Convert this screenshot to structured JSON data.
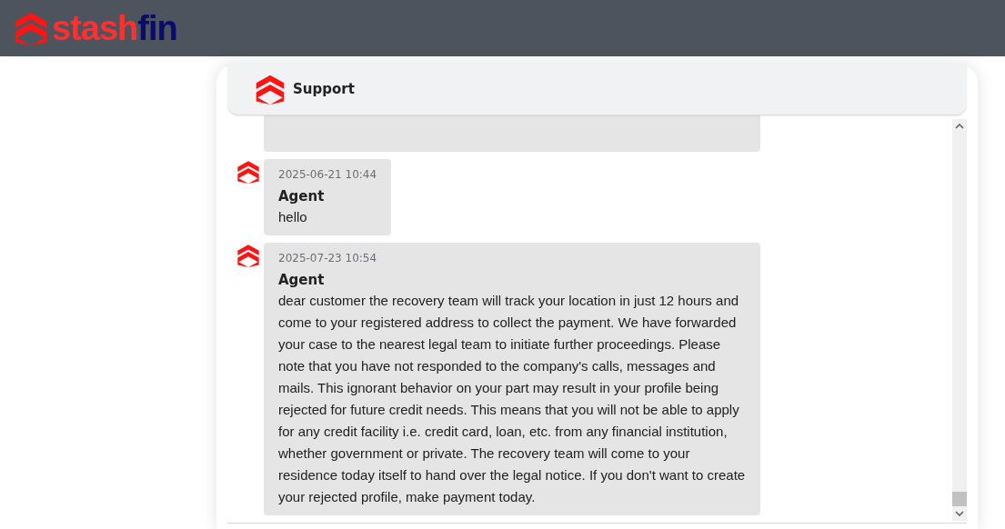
{
  "wordmark": [
    {
      "text": "stash",
      "color": "#ff3030"
    },
    {
      "text": "fin",
      "color": "#0b0b6b"
    }
  ],
  "chat": {
    "title": "Support",
    "messages": [
      {
        "time": "2025-06-21 10:44",
        "sender": "Agent",
        "text": "hello"
      },
      {
        "time": "2025-07-23 10:54",
        "sender": "Agent",
        "text": "dear customer the recovery team will track your location in just 12 hours and come to your registered address to collect the payment. We have forwarded your case to the nearest legal team to initiate further proceedings. Please note that you have not responded to the company's calls, messages and mails. This ignorant behavior on your part may result in your profile being rejected for future credit needs. This means that you will not be able to apply for any credit facility i.e. credit card, loan, etc. from any financial institution, whether government or private. The recovery team will come to your residence today itself to hand over the legal notice. If you don't want to create your rejected profile, make payment today."
      }
    ]
  }
}
